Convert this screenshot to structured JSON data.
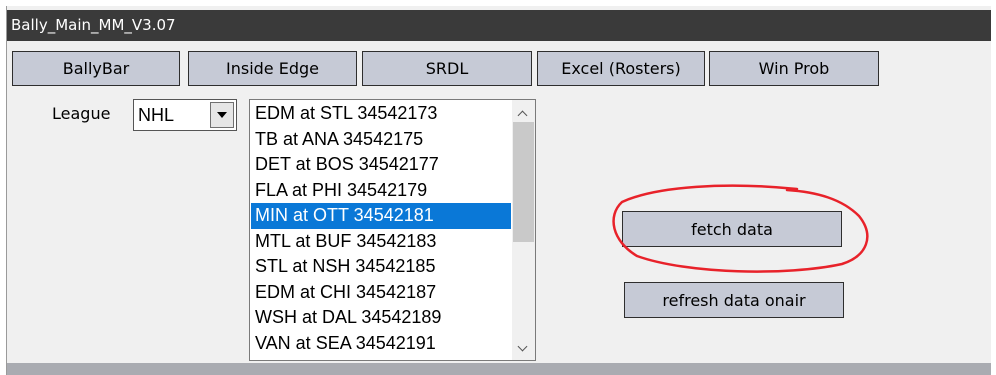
{
  "window": {
    "title": "Bally_Main_MM_V3.07"
  },
  "tabs": [
    {
      "label": "BallyBar"
    },
    {
      "label": "Inside Edge"
    },
    {
      "label": "SRDL"
    },
    {
      "label": "Excel (Rosters)"
    },
    {
      "label": "Win Prob"
    }
  ],
  "league": {
    "label": "League",
    "selected": "NHL"
  },
  "games": {
    "selected_index": 4,
    "items": [
      "EDM at STL 34542173",
      "TB at ANA 34542175",
      "DET at BOS 34542177",
      "FLA at PHI 34542179",
      "MIN at OTT 34542181",
      "MTL at BUF 34542183",
      "STL at NSH 34542185",
      "EDM at CHI 34542187",
      "WSH at DAL 34542189",
      "VAN at SEA 34542191"
    ]
  },
  "actions": {
    "fetch_label": "fetch data",
    "refresh_label": "refresh data onair"
  },
  "colors": {
    "titlebar": "#3a3a3a",
    "button": "#c6cad6",
    "selection": "#0a78d7",
    "annotation": "#e8222a"
  }
}
